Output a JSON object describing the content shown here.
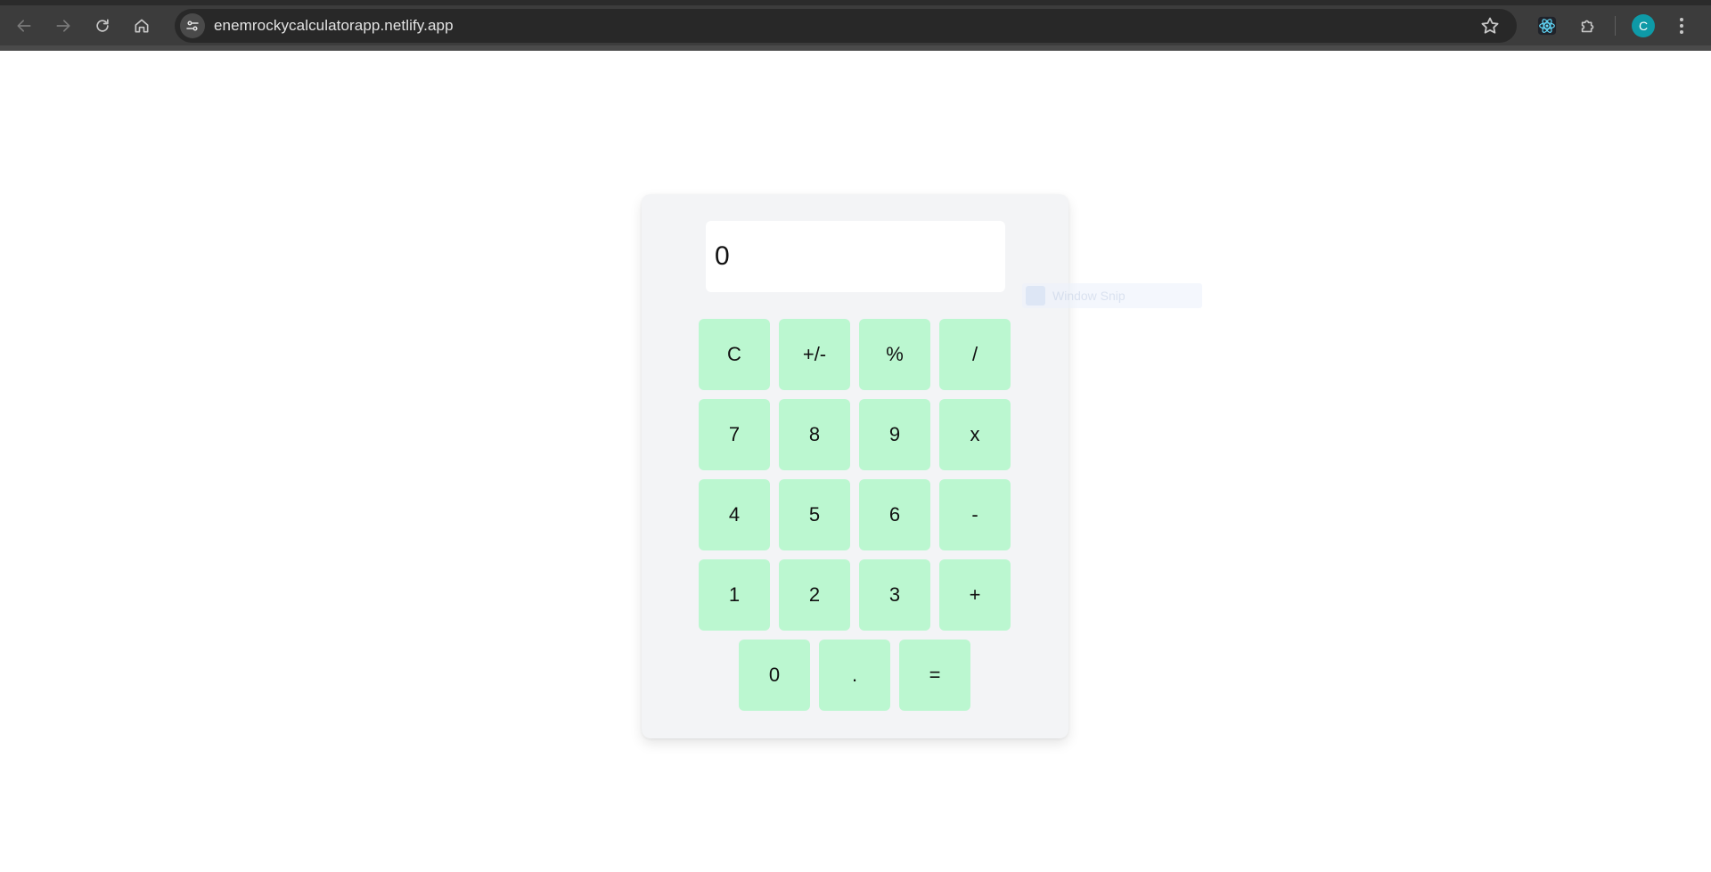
{
  "browser": {
    "url": "enemrockycalculatorapp.netlify.app",
    "profile_initial": "C",
    "icons": {
      "back": "back-arrow-icon",
      "forward": "forward-arrow-icon",
      "reload": "reload-icon",
      "home": "home-icon",
      "site_info": "tune-icon",
      "bookmark": "star-icon",
      "react_devtools": "react-atom-icon",
      "extensions": "puzzle-piece-icon",
      "menu": "three-dots-vertical-icon"
    },
    "colors": {
      "chrome_bg": "#3c3c3c",
      "omnibox_bg": "#282828",
      "avatar_bg": "#0e9aa7"
    }
  },
  "calculator": {
    "display_value": "0",
    "rows": [
      [
        "C",
        "+/-",
        "%",
        "/"
      ],
      [
        "7",
        "8",
        "9",
        "x"
      ],
      [
        "4",
        "5",
        "6",
        "-"
      ],
      [
        "1",
        "2",
        "3",
        "+"
      ],
      [
        "0",
        ".",
        "="
      ]
    ],
    "colors": {
      "panel_bg": "#f3f4f6",
      "key_bg": "#bbf7d0",
      "display_bg": "#ffffff"
    }
  },
  "overlay": {
    "label": "Window Snip"
  }
}
